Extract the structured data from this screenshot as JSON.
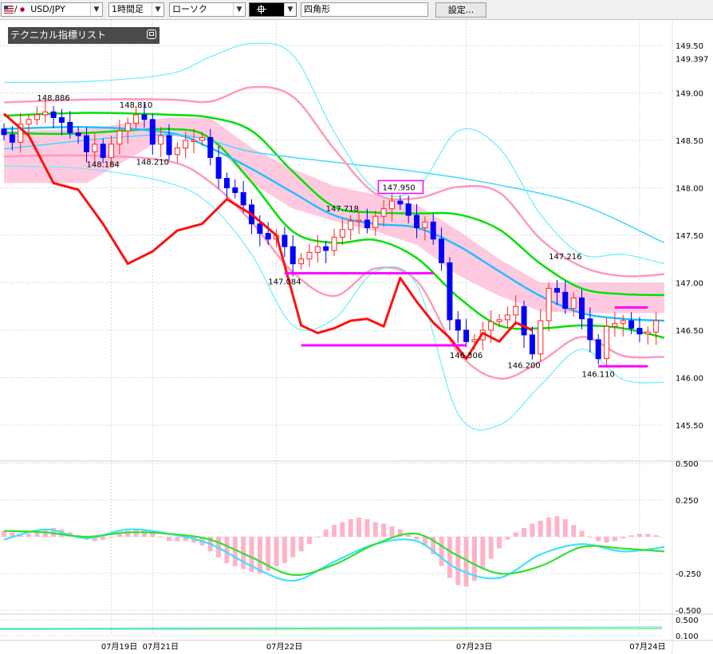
{
  "toolbar": {
    "symbol": "USD/JPY",
    "timeframe": "1時間足",
    "chart_style": "ローソク",
    "line_tool_icon": "crosshair-icon",
    "drawing_shape": "四角形",
    "settings_label": "設定..."
  },
  "indicator_panel": {
    "label": "テクニカル指標リスト"
  },
  "chart_data": {
    "type": "candlestick",
    "symbol": "USD/JPY",
    "y_axis_labels": [
      "149.50",
      "149.397",
      "149.00",
      "148.50",
      "148.00",
      "147.50",
      "147.00",
      "146.50",
      "146.00",
      "145.50"
    ],
    "y_range": [
      145.2,
      149.6
    ],
    "price_annotations": [
      {
        "label": "148.886",
        "t": 6,
        "v": 148.886
      },
      {
        "label": "148.810",
        "t": 16,
        "v": 148.81
      },
      {
        "label": "148.184",
        "t": 12,
        "v": 148.184
      },
      {
        "label": "148.210",
        "t": 18,
        "v": 148.21
      },
      {
        "label": "147.718",
        "t": 41,
        "v": 147.718
      },
      {
        "label": "147.950",
        "t": 47,
        "v": 147.95
      },
      {
        "label": "147.084",
        "t": 34,
        "v": 147.084
      },
      {
        "label": "147.216",
        "t": 68,
        "v": 147.216
      },
      {
        "label": "146.306",
        "t": 56,
        "v": 146.306
      },
      {
        "label": "146.200",
        "t": 63,
        "v": 146.2
      },
      {
        "label": "146.110",
        "t": 72,
        "v": 146.11
      }
    ],
    "close": [
      148.56,
      148.48,
      148.67,
      148.72,
      148.77,
      148.8,
      148.74,
      148.69,
      148.58,
      148.55,
      148.38,
      148.46,
      148.32,
      148.46,
      148.6,
      148.68,
      148.77,
      148.72,
      148.46,
      148.55,
      148.35,
      148.42,
      148.5,
      148.5,
      148.53,
      148.32,
      148.1,
      148.0,
      147.95,
      147.82,
      147.62,
      147.52,
      147.46,
      147.5,
      147.38,
      147.2,
      147.25,
      147.32,
      147.38,
      147.34,
      147.48,
      147.56,
      147.65,
      147.66,
      147.58,
      147.7,
      147.78,
      147.86,
      147.83,
      147.71,
      147.58,
      147.64,
      147.46,
      147.21,
      146.61,
      146.5,
      146.38,
      146.4,
      146.5,
      146.59,
      146.61,
      146.66,
      146.75,
      146.45,
      146.25,
      146.6,
      146.94,
      146.9,
      146.73,
      146.84,
      146.62,
      146.4,
      146.2,
      146.54,
      146.57,
      146.6,
      146.52,
      146.46,
      146.48,
      146.6
    ],
    "ohlc_note": "open of each candle equals the previous close",
    "series": [
      {
        "name": "sma_short",
        "color": "#00e000",
        "x": [
          0,
          8,
          20,
          25,
          30,
          35,
          40,
          45,
          50,
          55,
          60,
          65,
          70,
          75,
          80
        ],
        "values": [
          148.58,
          148.57,
          148.62,
          148.52,
          148.06,
          147.54,
          147.42,
          147.45,
          147.26,
          146.85,
          146.55,
          146.52,
          146.55,
          146.52,
          146.42
        ]
      },
      {
        "name": "sma_long",
        "color": "#00e000",
        "x": [
          0,
          10,
          20,
          25,
          30,
          35,
          40,
          45,
          50,
          55,
          60,
          65,
          70,
          75,
          80
        ],
        "values": [
          148.76,
          148.79,
          148.77,
          148.74,
          148.6,
          148.17,
          147.8,
          147.74,
          147.73,
          147.72,
          147.56,
          147.2,
          146.94,
          146.88,
          146.87
        ]
      },
      {
        "name": "ema",
        "color": "#20c0ff",
        "x": [
          0,
          10,
          20,
          25,
          30,
          35,
          40,
          45,
          50,
          55,
          60,
          65,
          70,
          75,
          80
        ],
        "values": [
          148.62,
          148.64,
          148.58,
          148.42,
          148.2,
          147.95,
          147.71,
          147.62,
          147.58,
          147.39,
          147.12,
          146.86,
          146.68,
          146.62,
          146.6
        ]
      },
      {
        "name": "ema_long",
        "color": "#40d8ff",
        "x": [
          0,
          20,
          30,
          40,
          50,
          60,
          70,
          80
        ],
        "values": [
          148.41,
          148.56,
          148.38,
          148.27,
          148.17,
          148.03,
          147.82,
          147.42
        ]
      },
      {
        "name": "bb_upper_1",
        "color": "#ff99bb",
        "x": [
          0,
          10,
          20,
          25,
          30,
          35,
          40,
          45,
          50,
          55,
          60,
          65,
          70,
          75,
          80
        ],
        "values": [
          148.9,
          148.93,
          148.93,
          148.91,
          149.06,
          148.96,
          148.41,
          147.94,
          147.89,
          148.01,
          147.95,
          147.46,
          147.17,
          147.07,
          147.09
        ]
      },
      {
        "name": "bb_lower_1",
        "color": "#ff99bb",
        "x": [
          0,
          10,
          20,
          25,
          30,
          35,
          40,
          45,
          50,
          55,
          60,
          65,
          70,
          75,
          80
        ],
        "values": [
          148.33,
          148.34,
          148.28,
          148.06,
          147.64,
          147.11,
          146.86,
          147.15,
          147.02,
          146.27,
          145.99,
          146.17,
          146.43,
          146.23,
          146.22
        ]
      },
      {
        "name": "bb_upper_2",
        "color": "#66eeff",
        "x": [
          0,
          10,
          20,
          25,
          30,
          35,
          40,
          45,
          50,
          55,
          60,
          65,
          70,
          75,
          80
        ],
        "values": [
          149.11,
          149.12,
          149.2,
          149.38,
          149.52,
          149.4,
          148.59,
          147.98,
          147.99,
          148.6,
          148.42,
          147.72,
          147.3,
          147.3,
          147.2
        ]
      },
      {
        "name": "bb_lower_2",
        "color": "#66eeff",
        "x": [
          0,
          10,
          20,
          25,
          30,
          35,
          40,
          45,
          50,
          55,
          60,
          65,
          70,
          75,
          80
        ],
        "values": [
          148.23,
          148.2,
          148.05,
          147.82,
          147.3,
          146.55,
          146.62,
          147.12,
          146.98,
          145.62,
          145.5,
          145.92,
          146.3,
          145.98,
          145.95
        ]
      },
      {
        "name": "trend_line",
        "color": "#ff1010",
        "x": [
          0,
          3,
          6,
          9,
          12,
          15,
          18,
          21,
          24,
          27,
          30,
          33,
          36,
          38,
          40,
          42,
          44,
          46,
          48,
          50,
          52,
          54,
          56,
          58,
          60,
          62,
          64
        ],
        "values": [
          148.78,
          148.55,
          148.05,
          147.98,
          147.62,
          147.2,
          147.33,
          147.55,
          147.62,
          147.88,
          147.72,
          147.5,
          146.55,
          146.47,
          146.52,
          146.6,
          146.62,
          146.54,
          147.05,
          146.8,
          146.58,
          146.42,
          146.2,
          146.47,
          146.38,
          146.58,
          146.5
        ]
      }
    ],
    "cloud": {
      "color": "#ffb8d6",
      "x": [
        0,
        10,
        20,
        25,
        30,
        35,
        40,
        45,
        50,
        55,
        60,
        65,
        70,
        75,
        80
      ],
      "top": [
        148.6,
        148.62,
        148.74,
        148.74,
        148.42,
        148.2,
        148.02,
        147.93,
        147.82,
        147.55,
        147.25,
        147.0,
        147.0,
        147.0,
        147.0
      ],
      "bottom": [
        148.05,
        148.05,
        148.55,
        148.5,
        148.05,
        147.78,
        147.65,
        147.54,
        147.4,
        147.08,
        146.86,
        146.7,
        146.68,
        146.68,
        146.68
      ]
    },
    "horizontal_lines": [
      {
        "color": "#ff00ff",
        "value": 147.1,
        "from": 34,
        "to": 52
      },
      {
        "color": "#ff00ff",
        "value": 146.34,
        "from": 36,
        "to": 56
      },
      {
        "color": "#ff00ff",
        "value": 146.74,
        "from": 74,
        "to": 78
      },
      {
        "color": "#ff00ff",
        "value": 146.12,
        "from": 72,
        "to": 78
      }
    ],
    "macd": {
      "y_labels": [
        "0.500",
        "0.250",
        "-0.250",
        "-0.500"
      ],
      "y_range": [
        -0.55,
        0.6
      ],
      "histogram": [
        0.04,
        0.03,
        0.02,
        0.02,
        0.03,
        0.05,
        0.06,
        0.05,
        0.03,
        0.01,
        -0.02,
        -0.03,
        -0.02,
        0.0,
        0.02,
        0.04,
        0.05,
        0.05,
        0.03,
        0.0,
        -0.03,
        -0.03,
        -0.03,
        -0.04,
        -0.06,
        -0.1,
        -0.14,
        -0.18,
        -0.2,
        -0.22,
        -0.24,
        -0.25,
        -0.23,
        -0.2,
        -0.18,
        -0.14,
        -0.1,
        -0.05,
        0.0,
        0.05,
        0.08,
        0.1,
        0.12,
        0.13,
        0.12,
        0.1,
        0.09,
        0.07,
        0.05,
        0.02,
        -0.02,
        -0.06,
        -0.12,
        -0.2,
        -0.28,
        -0.33,
        -0.34,
        -0.3,
        -0.22,
        -0.15,
        -0.08,
        -0.02,
        0.03,
        0.06,
        0.09,
        0.11,
        0.13,
        0.14,
        0.12,
        0.08,
        0.04,
        0.0,
        -0.03,
        -0.04,
        -0.03,
        -0.01,
        0.01,
        0.02,
        0.02,
        0.01
      ],
      "lines": [
        {
          "name": "macd_line",
          "color": "#40e0ff",
          "x": [
            0,
            5,
            10,
            15,
            20,
            25,
            30,
            35,
            40,
            45,
            50,
            55,
            60,
            65,
            70,
            75,
            80
          ],
          "values": [
            -0.02,
            0.05,
            -0.01,
            0.05,
            0.02,
            -0.05,
            -0.2,
            -0.3,
            -0.17,
            -0.05,
            -0.03,
            -0.22,
            -0.28,
            -0.12,
            -0.05,
            -0.1,
            -0.07
          ]
        },
        {
          "name": "signal_line",
          "color": "#30e030",
          "x": [
            0,
            5,
            10,
            15,
            20,
            25,
            30,
            35,
            40,
            45,
            50,
            55,
            60,
            65,
            70,
            75,
            80
          ],
          "values": [
            0.04,
            0.03,
            0.0,
            0.03,
            0.02,
            -0.02,
            -0.14,
            -0.26,
            -0.19,
            -0.05,
            0.02,
            -0.13,
            -0.25,
            -0.2,
            -0.07,
            -0.08,
            -0.1
          ]
        }
      ]
    },
    "third_panel": {
      "y_labels": [
        "0.500",
        "0.100"
      ]
    },
    "x_labels": [
      {
        "label": "07月19日",
        "t": 13
      },
      {
        "label": "07月21日",
        "t": 18
      },
      {
        "label": "07月22日",
        "t": 33
      },
      {
        "label": "07月23日",
        "t": 56
      },
      {
        "label": "07月24日",
        "t": 77
      }
    ],
    "grid": true,
    "colors": {
      "up_candle": "#ff2020",
      "down_candle": "#0000ff",
      "box_annotation": "#ff00ff"
    }
  }
}
